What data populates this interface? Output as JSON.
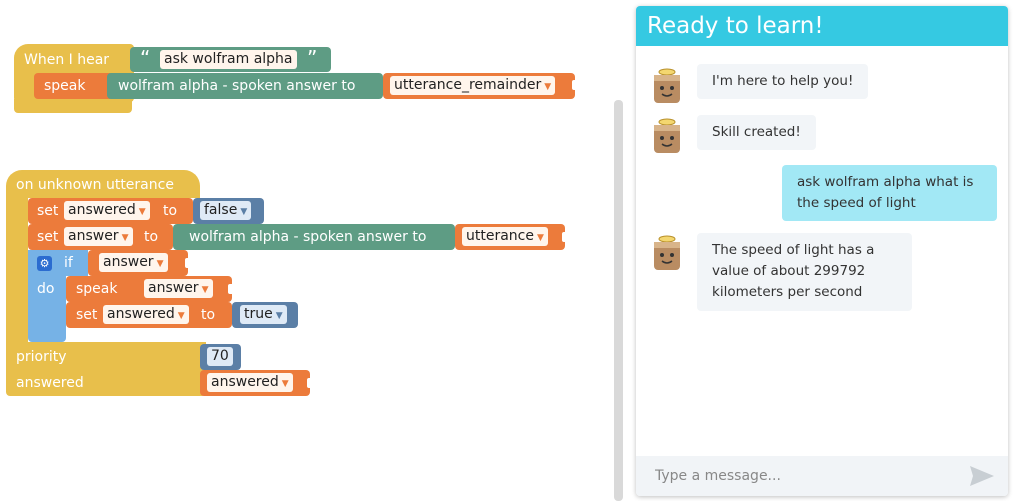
{
  "workspace": {
    "block1": {
      "hat_label": "When I hear",
      "open_quote": "“",
      "phrase": "ask wolfram alpha",
      "close_quote": "”",
      "speak_label": "speak",
      "wolfram_label": "wolfram alpha - spoken answer to",
      "var_label": "utterance_remainder"
    },
    "block2": {
      "hat_label": "on unknown utterance",
      "set1_label": "set",
      "set1_var": "answered",
      "set1_to": "to",
      "set1_value": "false",
      "set2_label": "set",
      "set2_var": "answer",
      "set2_to": "to",
      "set2_wolfram": "wolfram alpha - spoken answer to",
      "set2_value": "utterance",
      "if_label": "if",
      "if_var": "answer",
      "do_label": "do",
      "speak_label": "speak",
      "speak_var": "answer",
      "set3_label": "set",
      "set3_var": "answered",
      "set3_to": "to",
      "set3_value": "true",
      "priority_label": "priority",
      "priority_value": "70",
      "answered_label": "answered",
      "answered_var": "answered"
    }
  },
  "chat": {
    "title": "Ready to learn!",
    "messages": [
      {
        "from": "bot",
        "text": "I'm here to help you!"
      },
      {
        "from": "bot",
        "text": "Skill created!"
      },
      {
        "from": "user",
        "text": "ask wolfram alpha what is the speed of light"
      },
      {
        "from": "bot",
        "text": "The speed of light has a value of about 299792 kilometers per second"
      }
    ],
    "input_placeholder": "Type a message...",
    "colors": {
      "header": "#35c9e2",
      "user_bubble": "#a2e8f5",
      "bot_bubble": "#f2f5f8"
    }
  },
  "icons": {
    "send": "send-icon",
    "gear": "gear-icon",
    "avatar": "robot-avatar-icon"
  }
}
